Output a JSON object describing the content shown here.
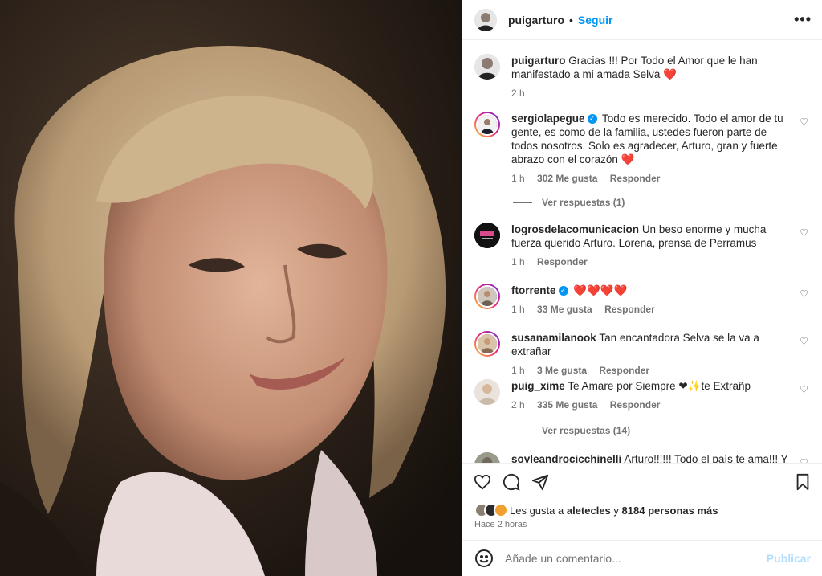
{
  "post": {
    "username": "puigarturo",
    "follow_label": "Seguir",
    "caption": "Gracias !!! Por Todo el Amor que le han manifestado a mi amada Selva ❤️",
    "caption_time": "2 h"
  },
  "comments": [
    {
      "user": "sergiolapegue",
      "verified": true,
      "text": "Todo es merecido. Todo el amor de tu gente, es como de la familia, ustedes fueron parte de todos nosotros. Solo es agradecer, Arturo, gran y fuerte abrazo con el corazón ❤️",
      "time": "1 h",
      "likes": "302 Me gusta",
      "reply": "Responder",
      "view_replies": "Ver respuestas (1)"
    },
    {
      "user": "logrosdelacomunicacion",
      "verified": false,
      "text": "Un beso enorme y mucha fuerza querido Arturo. Lorena, prensa de Perramus",
      "time": "1 h",
      "likes": "",
      "reply": "Responder"
    },
    {
      "user": "ftorrente",
      "verified": true,
      "text": "❤️❤️❤️❤️",
      "time": "1 h",
      "likes": "33 Me gusta",
      "reply": "Responder"
    },
    {
      "user": "susanamilanook",
      "verified": false,
      "text": "Tan encantadora Selva se la va a extrañar",
      "time": "1 h",
      "likes": "3 Me gusta",
      "reply": "Responder"
    },
    {
      "user": "puig_xime",
      "verified": false,
      "text": "Te Amare por Siempre ❤✨te Extrañp",
      "time": "2 h",
      "likes": "335 Me gusta",
      "reply": "Responder",
      "view_replies": "Ver respuestas (14)"
    },
    {
      "user": "soyleandrocicchinelli",
      "verified": false,
      "text": "Arturo!!!!!! Todo el país te ama!!! Y"
    }
  ],
  "likes": {
    "prefix": "Les gusta a",
    "user": "aletecles",
    "and": "y",
    "others": "8184 personas más"
  },
  "time_ago": "Hace 2 horas",
  "add_comment": {
    "placeholder": "Añade un comentario...",
    "publish_label": "Publicar"
  },
  "icons": {
    "heart": "heart-icon",
    "comment": "comment-icon",
    "share": "share-icon",
    "save": "bookmark-icon",
    "emoji": "emoji-icon",
    "more": "more-options-icon"
  },
  "colors": {
    "accent": "#0095f6",
    "publish_disabled": "#b2dffc",
    "muted_text": "#737373"
  }
}
